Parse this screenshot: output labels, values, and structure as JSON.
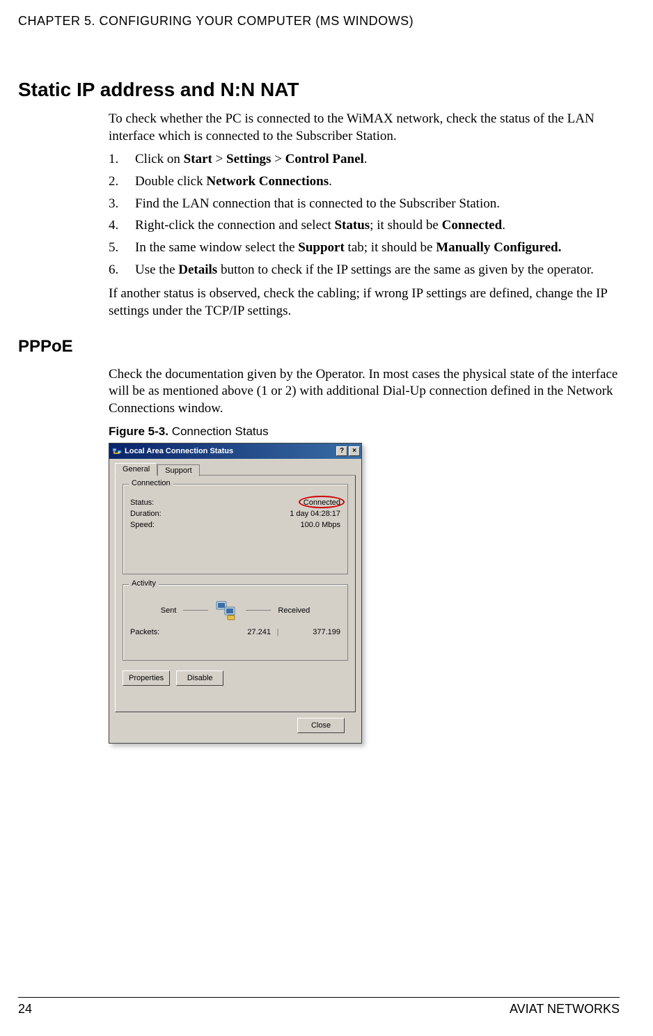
{
  "header": {
    "chapter": "CHAPTER 5. CONFIGURING YOUR COMPUTER (MS WINDOWS)"
  },
  "section1": {
    "title": "Static IP address and N:N NAT",
    "intro": "To check whether the PC is connected to the WiMAX network, check the status of the LAN interface which is connected to the Subscriber Station.",
    "steps": {
      "s1a": "Click on ",
      "s1b": "Start",
      "s1c": " > ",
      "s1d": "Settings",
      "s1e": " > ",
      "s1f": "Control Panel",
      "s1g": ".",
      "s2a": "Double click ",
      "s2b": "Network Connections",
      "s2c": ".",
      "s3": "Find the LAN connection that is connected to the Subscriber Station.",
      "s4a": "Right-click the connection and select ",
      "s4b": "Status",
      "s4c": "; it should be ",
      "s4d": "Connected",
      "s4e": ".",
      "s5a": "In the same window select the ",
      "s5b": "Support",
      "s5c": " tab; it should be ",
      "s5d": "Manually Configured.",
      "s6a": "Use the ",
      "s6b": "Details",
      "s6c": " button to check if the IP settings are the same as given by the operator."
    },
    "closing": "If another status is observed, check the cabling; if wrong IP settings are defined, change the IP settings under the TCP/IP settings."
  },
  "section2": {
    "title": "PPPoE",
    "para": "Check the documentation given by the Operator. In most cases the physical state of the interface will be as mentioned above (1 or 2) with additional Dial-Up connection defined in the Network Connections window.",
    "figure": {
      "label": "Figure 5-3.",
      "title": " Connection Status"
    }
  },
  "dialog": {
    "title": "Local Area Connection Status",
    "help_btn": "?",
    "close_btn": "×",
    "tabs": {
      "general": "General",
      "support": "Support"
    },
    "connection": {
      "legend": "Connection",
      "status_label": "Status:",
      "status_value": "Connected",
      "duration_label": "Duration:",
      "duration_value": "1 day 04:28:17",
      "speed_label": "Speed:",
      "speed_value": "100.0 Mbps"
    },
    "activity": {
      "legend": "Activity",
      "sent": "Sent",
      "received": "Received",
      "packets_label": "Packets:",
      "sent_value": "27.241",
      "recv_value": "377.199"
    },
    "buttons": {
      "properties": "Properties",
      "disable": "Disable",
      "close": "Close"
    }
  },
  "footer": {
    "page": "24",
    "brand": "AVIAT NETWORKS"
  }
}
